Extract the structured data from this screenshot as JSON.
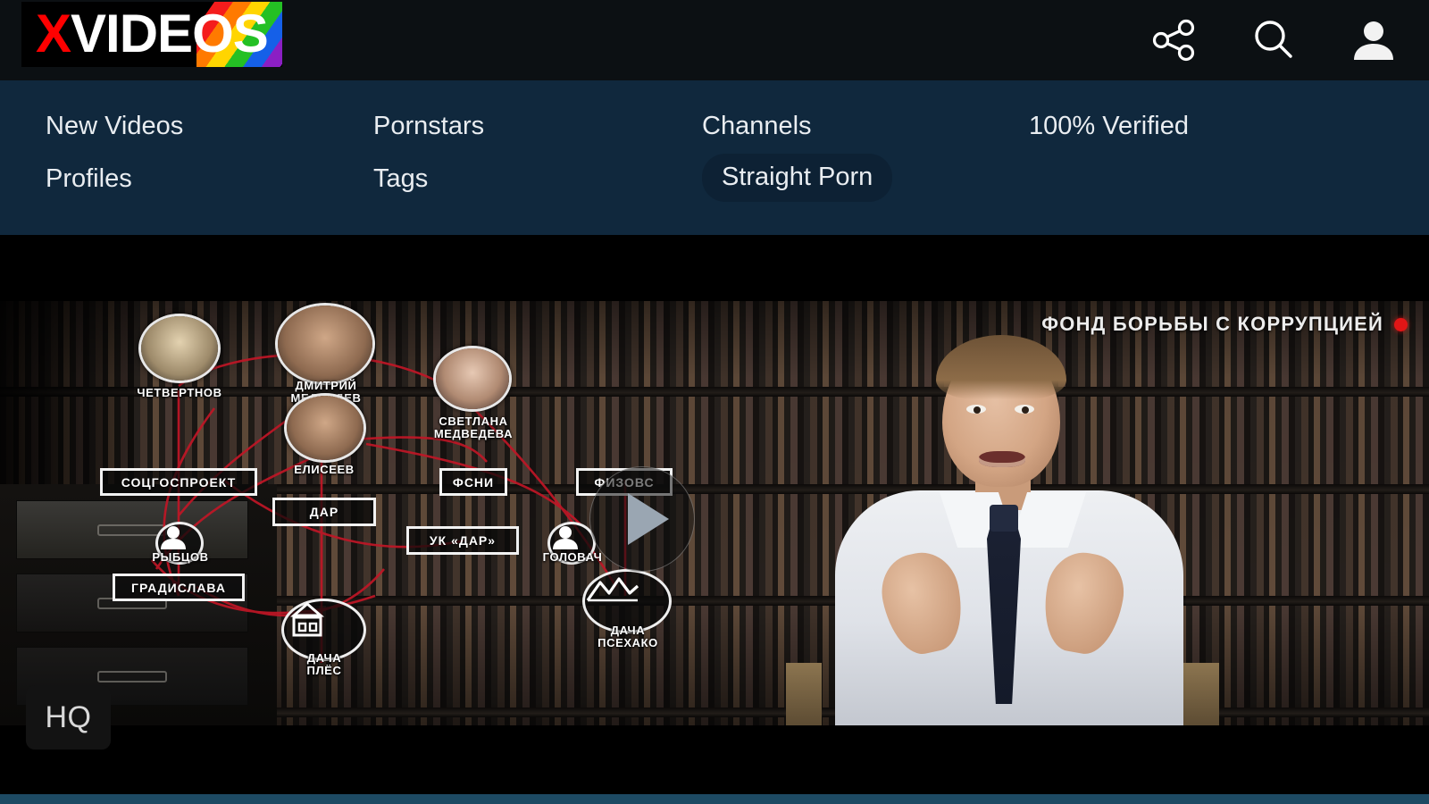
{
  "site": {
    "logo_x": "X",
    "logo_rest": "VIDEOS",
    "logo_full": "XVIDEOS"
  },
  "header": {
    "icons": [
      {
        "name": "share-icon",
        "label": "Share"
      },
      {
        "name": "search-icon",
        "label": "Search"
      },
      {
        "name": "account-icon",
        "label": "Account"
      }
    ],
    "background_color": "#0c1013"
  },
  "nav": {
    "background_color": "#10283d",
    "items": [
      {
        "label": "New Videos",
        "row": 1,
        "col": 1
      },
      {
        "label": "Pornstars",
        "row": 1,
        "col": 2
      },
      {
        "label": "Channels",
        "row": 1,
        "col": 3
      },
      {
        "label": "100% Verified",
        "row": 1,
        "col": 4
      },
      {
        "label": "Profiles",
        "row": 2,
        "col": 1
      },
      {
        "label": "Tags",
        "row": 2,
        "col": 2
      }
    ],
    "active_pill": {
      "label": "Straight Porn",
      "background_color": "#0d2134"
    }
  },
  "player": {
    "quality_badge": "HQ",
    "play_button_label": "Play",
    "watermark": {
      "text": "ФОНД БОРЬБЫ С КОРРУПЦИЕЙ",
      "dot_color": "#e01616"
    },
    "diagram": {
      "person_nodes": [
        {
          "id": "chetvertnov",
          "label": "ЧЕТВЕРТНОВ"
        },
        {
          "id": "medvedev",
          "label": "ДМИТРИЙ\nМЕДВЕДЕВ"
        },
        {
          "id": "svetlana",
          "label": "СВЕТЛАНА\nМЕДВЕДЕВА"
        },
        {
          "id": "eliseev",
          "label": "ЕЛИСЕЕВ"
        }
      ],
      "icon_nodes": [
        {
          "id": "rybtsov",
          "label": "РЫБЦОВ",
          "icon": "person-silhouette-icon"
        },
        {
          "id": "golovach",
          "label": "ГОЛОВАЧ",
          "icon": "person-silhouette-icon"
        },
        {
          "id": "dacha-ples",
          "label": "ДАЧА\nПЛЁС",
          "icon": "house-icon"
        },
        {
          "id": "dacha-psekhako",
          "label": "ДАЧА\nПСЕХАКО",
          "icon": "mountains-icon"
        }
      ],
      "box_nodes": [
        {
          "id": "socgosproekt",
          "label": "СОЦГОСПРОЕКТ"
        },
        {
          "id": "fsni",
          "label": "ФСНИ"
        },
        {
          "id": "fizovs",
          "label": "ФИЗОВС"
        },
        {
          "id": "dar",
          "label": "ДАР"
        },
        {
          "id": "uk-dar",
          "label": "УК «ДАР»"
        },
        {
          "id": "gradislava",
          "label": "ГРАДИСЛАВА"
        }
      ],
      "link_color": "#c01626"
    }
  },
  "footer": {
    "strip_color": "#1d4a63"
  }
}
